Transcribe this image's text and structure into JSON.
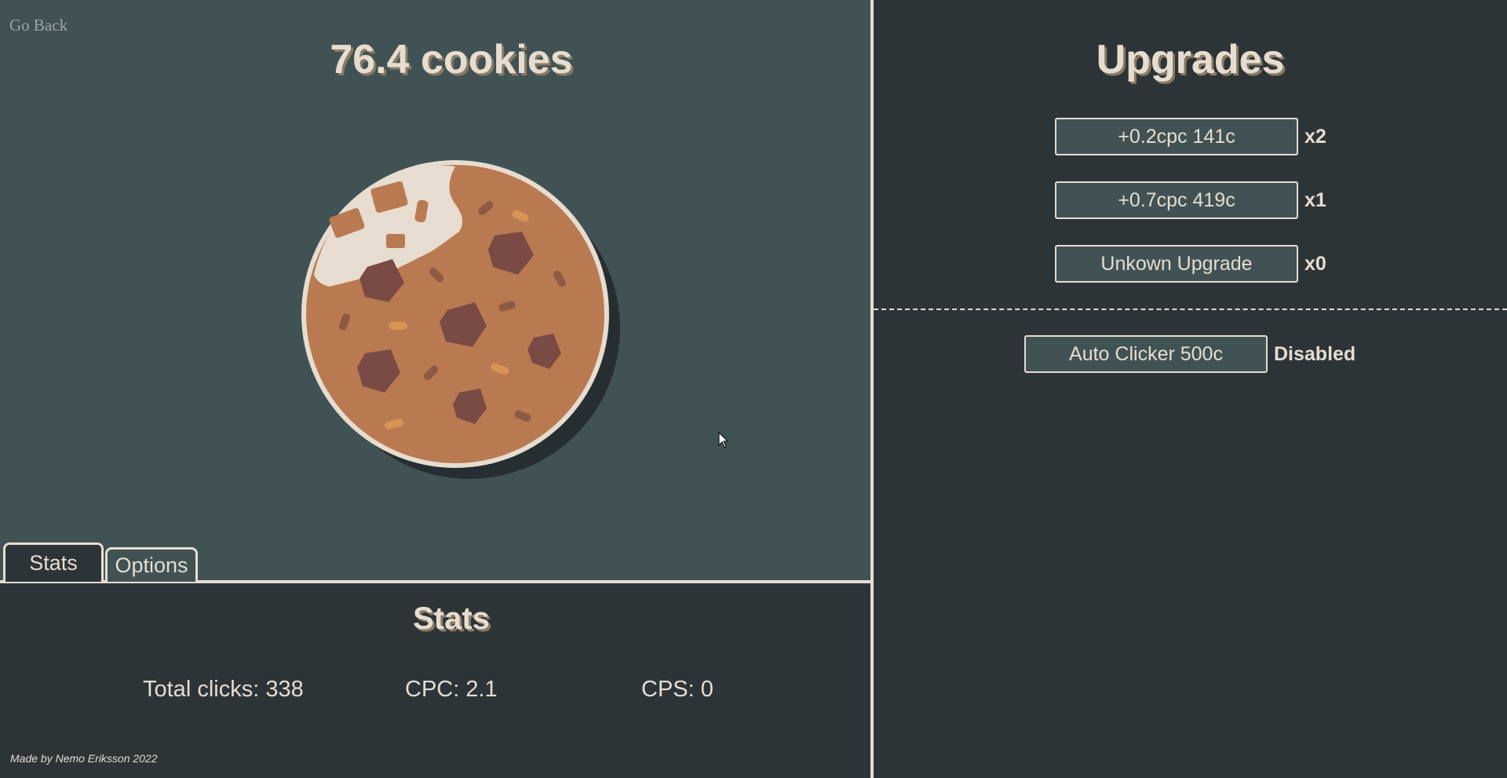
{
  "left_panel": {
    "go_back": "Go Back",
    "cookie_count": "76.4 cookies",
    "tabs": [
      {
        "label": "Stats",
        "active": true
      },
      {
        "label": "Options",
        "active": false
      }
    ]
  },
  "stats": {
    "title": "Stats",
    "total_clicks": "Total clicks: 338",
    "cpc": "CPC: 2.1",
    "cps": "CPS: 0"
  },
  "footer": "Made by Nemo Eriksson 2022",
  "upgrades": {
    "title": "Upgrades",
    "items": [
      {
        "label": "+0.2cpc 141c",
        "count": "x2"
      },
      {
        "label": "+0.7cpc 419c",
        "count": "x1"
      },
      {
        "label": "Unkown Upgrade",
        "count": "x0"
      }
    ],
    "auto_clicker": {
      "label": "Auto Clicker 500c",
      "status": "Disabled"
    }
  },
  "colors": {
    "panel_dark": "#2d3438",
    "panel_light": "#415254",
    "cream": "#e6ddd0",
    "cookie": "#b97a52",
    "chip": "#7a4a44"
  }
}
